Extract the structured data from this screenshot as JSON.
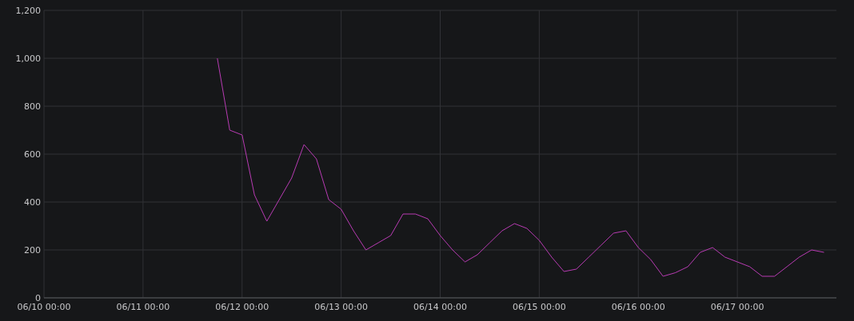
{
  "chart_data": {
    "type": "line",
    "grid": true,
    "categories": [
      "06/10 00:00",
      null,
      null,
      null,
      null,
      null,
      null,
      null,
      "06/11 00:00",
      null,
      null,
      null,
      null,
      null,
      null,
      null,
      "06/12 00:00",
      null,
      null,
      null,
      null,
      null,
      null,
      null,
      "06/13 00:00",
      null,
      null,
      null,
      null,
      null,
      null,
      null,
      "06/14 00:00",
      null,
      null,
      null,
      null,
      null,
      null,
      null,
      "06/15 00:00",
      null,
      null,
      null,
      null,
      null,
      null,
      null,
      "06/16 00:00",
      null,
      null,
      null,
      null,
      null,
      null,
      null,
      "06/17 00:00",
      null,
      null,
      null,
      null,
      null,
      null,
      null
    ],
    "ylim": [
      0,
      1200
    ],
    "yticks": [
      {
        "value": 0,
        "label": "0"
      },
      {
        "value": 200,
        "label": "200"
      },
      {
        "value": 400,
        "label": "400"
      },
      {
        "value": 600,
        "label": "600"
      },
      {
        "value": 800,
        "label": "800"
      },
      {
        "value": 1000,
        "label": "1,000"
      },
      {
        "value": 1200,
        "label": "1,200"
      }
    ],
    "series": [
      {
        "color": "#b83bb3",
        "values": [
          null,
          null,
          null,
          null,
          null,
          null,
          null,
          null,
          null,
          null,
          null,
          null,
          null,
          null,
          1000,
          700,
          680,
          430,
          320,
          410,
          500,
          640,
          580,
          410,
          370,
          280,
          200,
          230,
          260,
          350,
          350,
          330,
          260,
          200,
          150,
          180,
          230,
          280,
          310,
          290,
          240,
          170,
          110,
          120,
          170,
          220,
          270,
          280,
          210,
          160,
          90,
          105,
          130,
          190,
          210,
          170,
          150,
          130,
          90,
          90,
          130,
          170,
          200,
          190
        ]
      }
    ]
  }
}
